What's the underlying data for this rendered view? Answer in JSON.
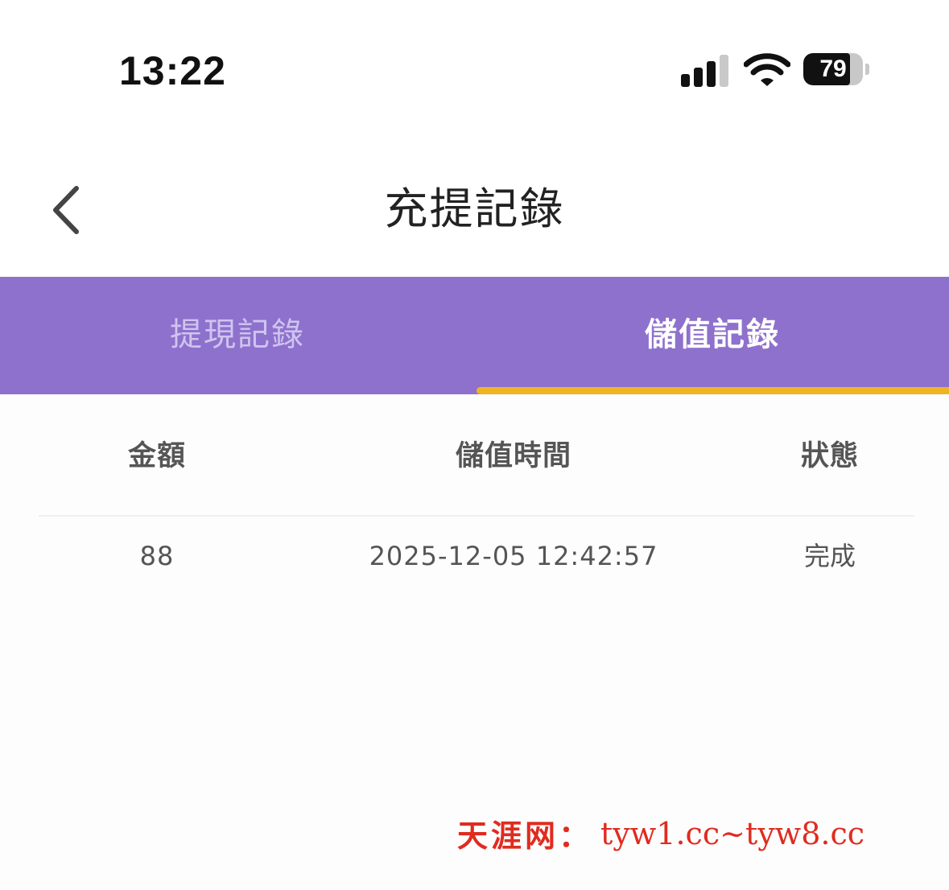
{
  "status_bar": {
    "time": "13:22",
    "battery_level": "79",
    "battery_fraction": 0.79,
    "signal_bars_active": 3,
    "signal_bars_total": 4,
    "icons": [
      "signal-icon",
      "wifi-icon",
      "battery-icon"
    ]
  },
  "nav": {
    "title": "充提記錄",
    "back_icon": "chevron-left-icon"
  },
  "tabs": [
    {
      "label": "提現記錄",
      "active": false
    },
    {
      "label": "儲值記錄",
      "active": true
    }
  ],
  "table": {
    "headers": {
      "amount": "金額",
      "time": "儲值時間",
      "status": "狀態"
    },
    "rows": [
      {
        "amount": "88",
        "time": "2025-12-05 12:42:57",
        "status": "完成"
      }
    ]
  },
  "watermark": {
    "brand": "天涯网：",
    "domains": "tyw1.cc~tyw8.cc"
  },
  "colors": {
    "tab_bar": "#8e71cc",
    "tab_indicator": "#f0b323",
    "watermark": "#e02b1f"
  }
}
